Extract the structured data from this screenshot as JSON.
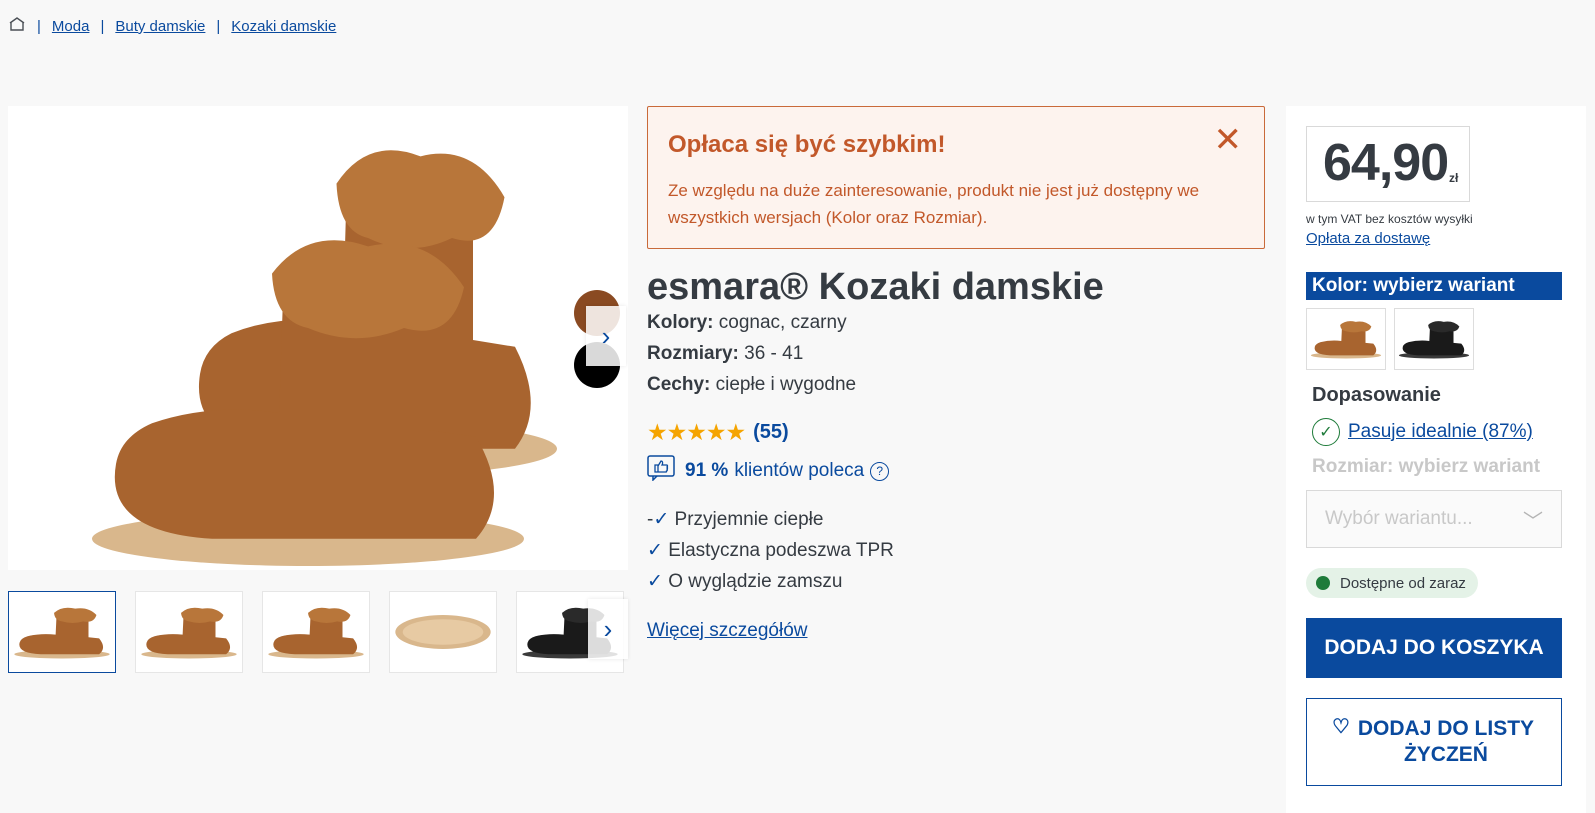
{
  "breadcrumb": {
    "home_icon": "home-icon",
    "sep": "|",
    "items": [
      "Moda",
      "Buty damskie",
      "Kozaki damskie"
    ]
  },
  "gallery": {
    "swatch_colors": [
      "#8a4a22",
      "#000000"
    ],
    "next_arrow": "›"
  },
  "alert": {
    "title": "Opłaca się być szybkim!",
    "text": "Ze względu na duże zainteresowanie, produkt nie jest już dostępny we wszystkich wersjach (Kolor oraz Rozmiar).",
    "close": "✕"
  },
  "product": {
    "title": "esmara® Kozaki damskie",
    "specs": [
      {
        "label": "Kolory:",
        "value": " cognac, czarny"
      },
      {
        "label": "Rozmiary:",
        "value": " 36 - 41"
      },
      {
        "label": "Cechy:",
        "value": " ciepłe i wygodne"
      }
    ],
    "stars": "★★★★★",
    "rating_count": "(55)",
    "recommend_pct": "91 %",
    "recommend_text": "klientów poleca",
    "recommend_help": "?",
    "features": [
      {
        "prefix": "-",
        "check": "✓",
        "text": " Przyjemnie ciepłe"
      },
      {
        "prefix": "",
        "check": "✓",
        "text": " Elastyczna podeszwa TPR"
      },
      {
        "prefix": "",
        "check": "✓",
        "text": " O wyglądzie zamszu"
      }
    ],
    "more_link": "Więcej szczegółów"
  },
  "panel": {
    "price": "64,90",
    "currency": "zł",
    "vat": "w tym VAT bez kosztów wysyłki",
    "delivery_link": "Opłata za dostawę",
    "color_label": "Kolor: wybierz wariant",
    "fit_title": "Dopasowanie",
    "fit_check": "✓",
    "fit_link": "Pasuje idealnie (87%)",
    "size_label": "Rozmiar: wybierz wariant",
    "select_placeholder": "Wybór wariantu...",
    "select_chevron": "﹀",
    "availability": "Dostępne od zaraz",
    "cart_button": "DODAJ DO KOSZYKA",
    "wish_heart": "♡",
    "wish_button": "DODAJ DO LISTY ŻYCZEŃ"
  },
  "colors": {
    "accent": "#0a4a9e",
    "alert": "#c2582a",
    "success": "#1e7b3a",
    "cognac": "#a8642f"
  }
}
